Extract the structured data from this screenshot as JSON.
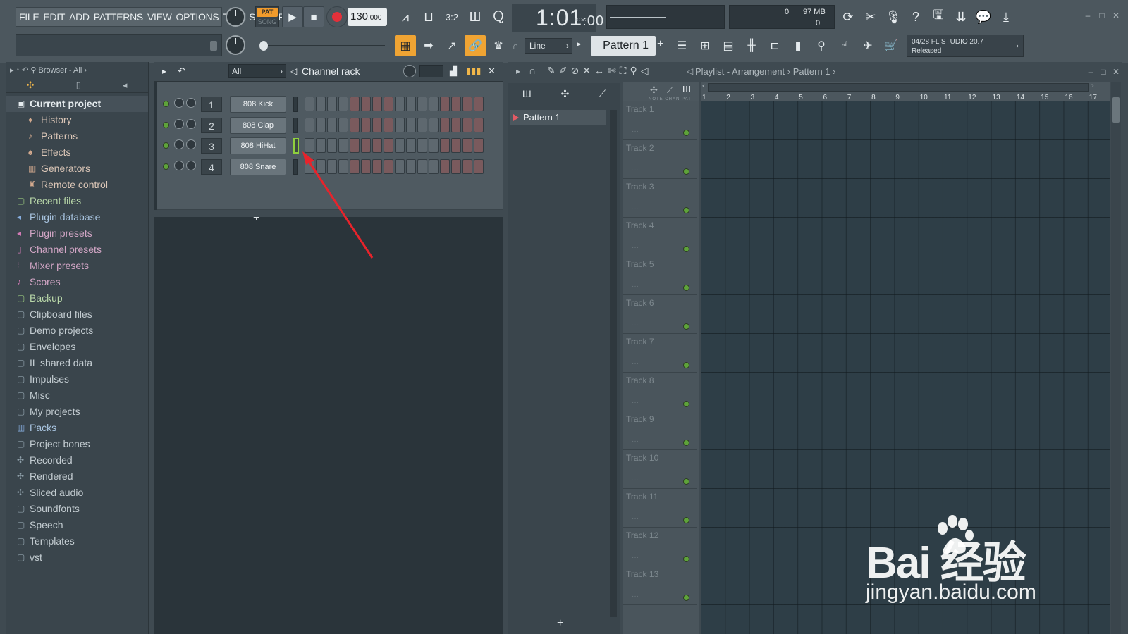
{
  "menu": [
    "FILE",
    "EDIT",
    "ADD",
    "PATTERNS",
    "VIEW",
    "OPTIONS",
    "TOOLS",
    "HELP"
  ],
  "transport": {
    "pat_label": "PAT",
    "song_label": "SONG",
    "tempo_main": "130",
    "tempo_dec": ".000",
    "time_main": "1:01",
    "time_sub": ":00",
    "time_unit": "B:S:T"
  },
  "meters": {
    "cpu_value": "0",
    "mem_value": "97 MB",
    "poly_value": "0"
  },
  "snap": {
    "line_mode": "Line",
    "pattern_name": "Pattern 1"
  },
  "info_panel": {
    "line1": "04/28  FL STUDIO 20.7",
    "line2": "Released"
  },
  "browser": {
    "header": "Browser - All",
    "items": [
      {
        "label": "Current project",
        "icon": "▣",
        "style": "current"
      },
      {
        "label": "History",
        "icon": "♦",
        "style": "sub"
      },
      {
        "label": "Patterns",
        "icon": "♪",
        "style": "sub"
      },
      {
        "label": "Effects",
        "icon": "♠",
        "style": "sub"
      },
      {
        "label": "Generators",
        "icon": "▥",
        "style": "sub"
      },
      {
        "label": "Remote control",
        "icon": "♜",
        "style": "sub"
      },
      {
        "label": "Recent files",
        "icon": "▢",
        "style": "green"
      },
      {
        "label": "Plugin database",
        "icon": "◂",
        "style": "blue"
      },
      {
        "label": "Plugin presets",
        "icon": "◂",
        "style": "pink"
      },
      {
        "label": "Channel presets",
        "icon": "▯",
        "style": "pink"
      },
      {
        "label": "Mixer presets",
        "icon": "⁞",
        "style": "pink"
      },
      {
        "label": "Scores",
        "icon": "♪",
        "style": "pink"
      },
      {
        "label": "Backup",
        "icon": "▢",
        "style": "green"
      },
      {
        "label": "Clipboard files",
        "icon": "▢",
        "style": "grey"
      },
      {
        "label": "Demo projects",
        "icon": "▢",
        "style": "grey"
      },
      {
        "label": "Envelopes",
        "icon": "▢",
        "style": "grey"
      },
      {
        "label": "IL shared data",
        "icon": "▢",
        "style": "grey"
      },
      {
        "label": "Impulses",
        "icon": "▢",
        "style": "grey"
      },
      {
        "label": "Misc",
        "icon": "▢",
        "style": "grey"
      },
      {
        "label": "My projects",
        "icon": "▢",
        "style": "grey"
      },
      {
        "label": "Packs",
        "icon": "▥",
        "style": "blue"
      },
      {
        "label": "Project bones",
        "icon": "▢",
        "style": "grey"
      },
      {
        "label": "Recorded",
        "icon": "✣",
        "style": "grey"
      },
      {
        "label": "Rendered",
        "icon": "✣",
        "style": "grey"
      },
      {
        "label": "Sliced audio",
        "icon": "✣",
        "style": "grey"
      },
      {
        "label": "Soundfonts",
        "icon": "▢",
        "style": "grey"
      },
      {
        "label": "Speech",
        "icon": "▢",
        "style": "grey"
      },
      {
        "label": "Templates",
        "icon": "▢",
        "style": "grey"
      },
      {
        "label": "vst",
        "icon": "▢",
        "style": "grey"
      }
    ]
  },
  "channel_rack": {
    "filter": "All",
    "title": "Channel rack",
    "add_label": "+",
    "channels": [
      {
        "num": "1",
        "name": "808 Kick"
      },
      {
        "num": "2",
        "name": "808 Clap"
      },
      {
        "num": "3",
        "name": "808 HiHat"
      },
      {
        "num": "4",
        "name": "808 Snare"
      }
    ]
  },
  "playlist": {
    "title": "Playlist - Arrangement",
    "sep": "›",
    "pattern_crumb": "Pattern 1",
    "picker_item": "Pattern 1",
    "add_label": "+",
    "header_labels": "NOTE  CHAN  PAT",
    "ruler": [
      "1",
      "2",
      "3",
      "4",
      "5",
      "6",
      "7",
      "8",
      "9",
      "10",
      "11",
      "12",
      "13",
      "14",
      "15",
      "16",
      "17"
    ],
    "tracks": [
      "Track 1",
      "Track 2",
      "Track 3",
      "Track 4",
      "Track 5",
      "Track 6",
      "Track 7",
      "Track 8",
      "Track 9",
      "Track 10",
      "Track 11",
      "Track 12",
      "Track 13"
    ]
  },
  "watermark": {
    "brand": "Bai 经验",
    "url": "jingyan.baidu.com"
  },
  "colors": {
    "accent_orange": "#f0a433",
    "record_red": "#e3303a",
    "led_green": "#5ea33a",
    "annotation_arrow": "#e8232b"
  }
}
